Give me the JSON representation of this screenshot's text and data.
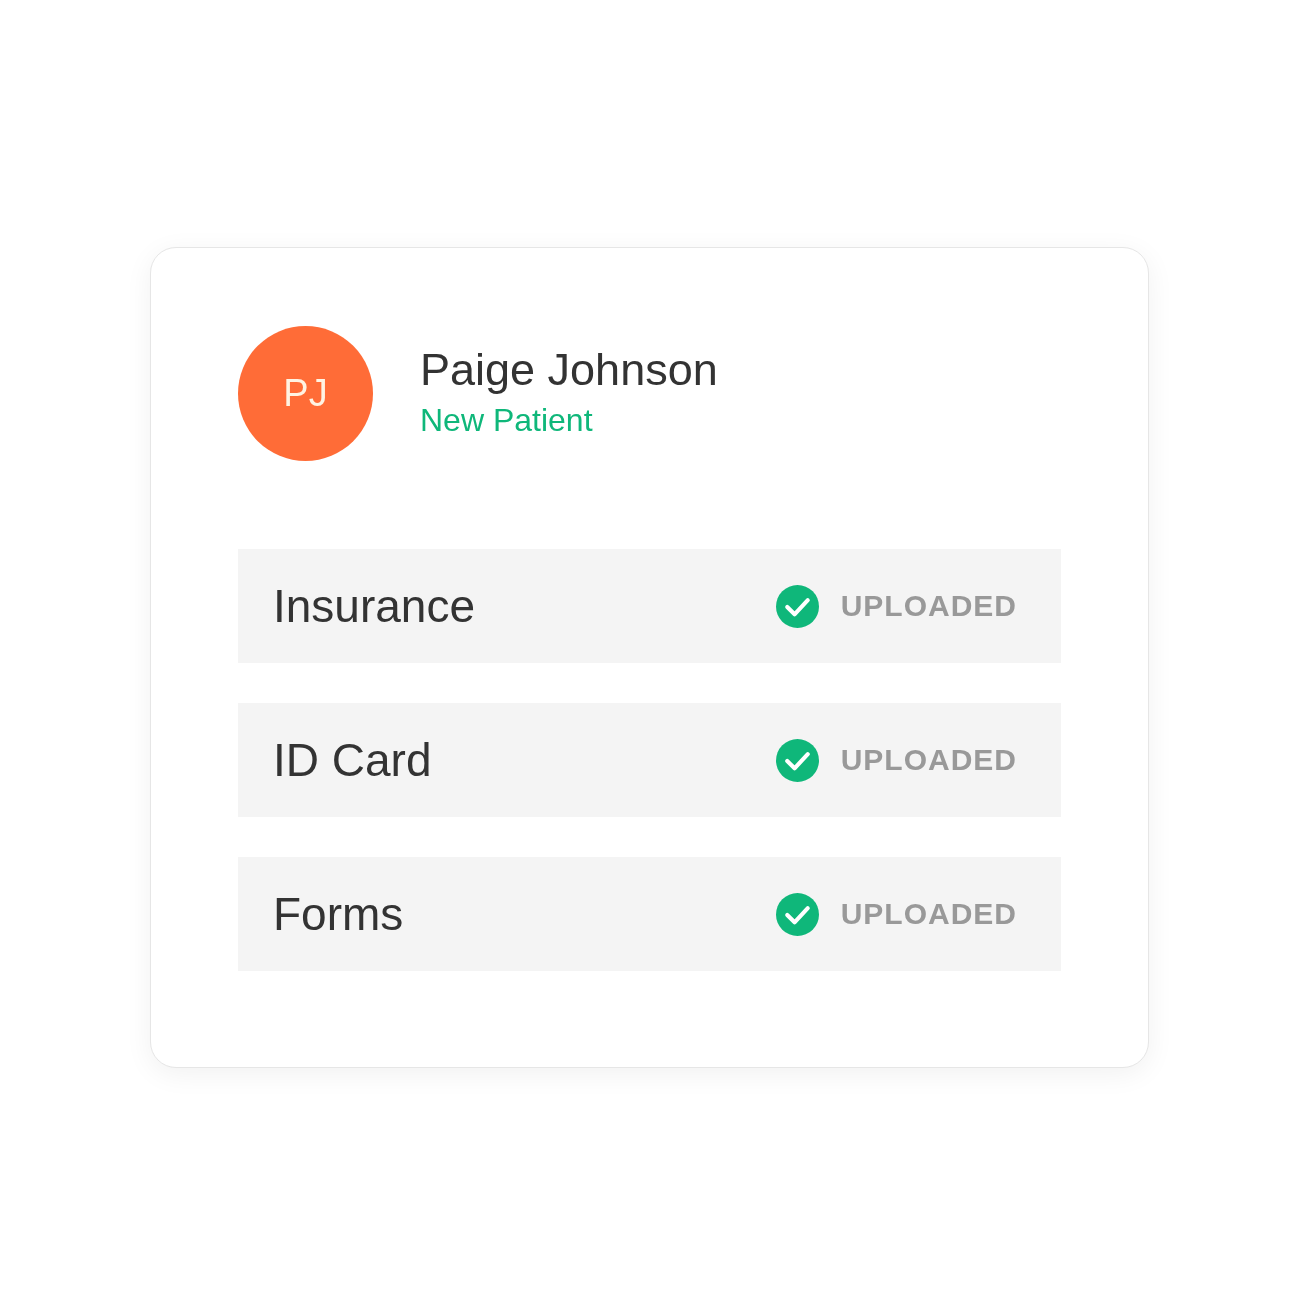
{
  "patient": {
    "initials": "PJ",
    "name": "Paige Johnson",
    "status": "New Patient"
  },
  "documents": [
    {
      "label": "Insurance",
      "status": "UPLOADED",
      "done": true
    },
    {
      "label": "ID Card",
      "status": "UPLOADED",
      "done": true
    },
    {
      "label": "Forms",
      "status": "UPLOADED",
      "done": true
    }
  ]
}
